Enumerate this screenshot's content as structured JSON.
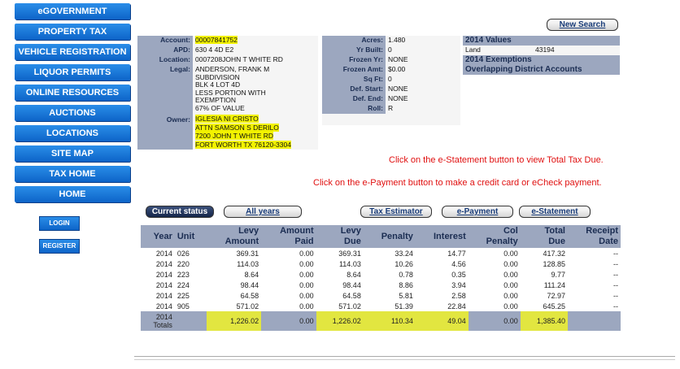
{
  "nav": [
    "eGOVERNMENT",
    "PROPERTY TAX",
    "VEHICLE REGISTRATION",
    "LIQUOR PERMITS",
    "ONLINE RESOURCES",
    "AUCTIONS",
    "LOCATIONS",
    "SITE MAP",
    "TAX HOME",
    "HOME"
  ],
  "auth": {
    "login": "LOGIN",
    "register": "REGISTER"
  },
  "new_search": "New Search",
  "account": {
    "account_label": "Account:",
    "account": "00007841752",
    "apd_label": "APD:",
    "apd": "630 4 4D E2",
    "location_label": "Location:",
    "location": "0007208JOHN T WHITE RD",
    "legal_label": "Legal:",
    "legal": [
      "ANDERSON, FRANK M",
      "SUBDIVISION",
      "BLK 4 LOT 4D",
      "LESS PORTION WITH",
      "EXEMPTION",
      "67% OF VALUE"
    ],
    "owner_label": "Owner:",
    "owner": [
      "IGLESIA NI CRISTO",
      "ATTN SAMSON S DERILO",
      "7200 JOHN T WHITE RD",
      "FORT WORTH TX 76120-3304"
    ]
  },
  "details": {
    "acres_label": "Acres:",
    "acres": "1.480",
    "yr_built_label": "Yr Built:",
    "yr_built": "0",
    "frozen_yr_label": "Frozen Yr:",
    "frozen_yr": "NONE",
    "frozen_amt_label": "Frozen Amt:",
    "frozen_amt": "$0.00",
    "sqft_label": "Sq Ft:",
    "sqft": "0",
    "def_start_label": "Def. Start:",
    "def_start": "NONE",
    "def_end_label": "Def. End:",
    "def_end": "NONE",
    "roll_label": "Roll:",
    "roll": "R"
  },
  "values": {
    "values_header": "2014 Values",
    "land_label": "Land",
    "land_value": "43194",
    "exemptions_header": "2014 Exemptions",
    "overlap_header": "Overlapping District Accounts"
  },
  "messages": {
    "estatement": "Click on the e-Statement button to view Total Tax Due.",
    "epayment": "Click on the e-Payment button to make a credit card or eCheck payment."
  },
  "tabs": {
    "current": "Current status",
    "all_years": "All years",
    "estimator": "Tax Estimator",
    "epayment": "e-Payment",
    "estatement": "e-Statement"
  },
  "table": {
    "headers": [
      [
        "Year"
      ],
      [
        "Unit"
      ],
      [
        "Levy",
        "Amount"
      ],
      [
        "Amount",
        "Paid"
      ],
      [
        "Levy",
        "Due"
      ],
      [
        "Penalty"
      ],
      [
        "Interest"
      ],
      [
        "Col",
        "Penalty"
      ],
      [
        "Total",
        "Due"
      ],
      [
        "Receipt",
        "Date"
      ]
    ],
    "rows": [
      [
        "2014",
        "026",
        "369.31",
        "0.00",
        "369.31",
        "33.24",
        "14.77",
        "0.00",
        "417.32",
        "--"
      ],
      [
        "2014",
        "220",
        "114.03",
        "0.00",
        "114.03",
        "10.26",
        "4.56",
        "0.00",
        "128.85",
        "--"
      ],
      [
        "2014",
        "223",
        "8.64",
        "0.00",
        "8.64",
        "0.78",
        "0.35",
        "0.00",
        "9.77",
        "--"
      ],
      [
        "2014",
        "224",
        "98.44",
        "0.00",
        "98.44",
        "8.86",
        "3.94",
        "0.00",
        "111.24",
        "--"
      ],
      [
        "2014",
        "225",
        "64.58",
        "0.00",
        "64.58",
        "5.81",
        "2.58",
        "0.00",
        "72.97",
        "--"
      ],
      [
        "2014",
        "905",
        "571.02",
        "0.00",
        "571.02",
        "51.39",
        "22.84",
        "0.00",
        "645.25",
        "--"
      ]
    ],
    "totals": {
      "year": "2014",
      "label": "Totals",
      "levy": "1,226.02",
      "paid": "0.00",
      "due": "1,226.02",
      "penalty": "110.34",
      "interest": "49.04",
      "col": "0.00",
      "total": "1,385.40"
    }
  }
}
